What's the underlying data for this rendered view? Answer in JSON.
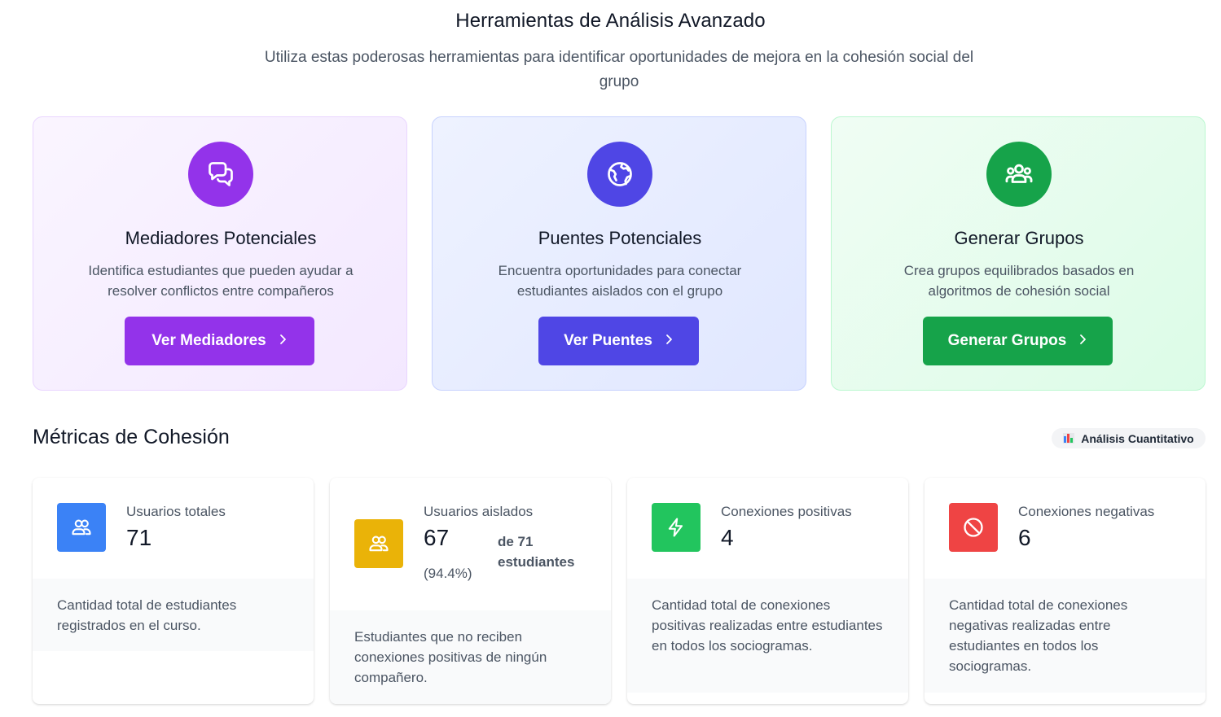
{
  "header": {
    "title": "Herramientas de Análisis Avanzado",
    "subtitle": "Utiliza estas poderosas herramientas para identificar oportunidades de mejora en la cohesión social del grupo"
  },
  "tools": [
    {
      "title": "Mediadores Potenciales",
      "description": "Identifica estudiantes que pueden ayudar a resolver conflictos entre compañeros",
      "button": "Ver Mediadores",
      "icon": "chat-bubbles-icon",
      "color": "#9333ea"
    },
    {
      "title": "Puentes Potenciales",
      "description": "Encuentra oportunidades para conectar estudiantes aislados con el grupo",
      "button": "Ver Puentes",
      "icon": "globe-icon",
      "color": "#4f46e5"
    },
    {
      "title": "Generar Grupos",
      "description": "Crea grupos equilibrados basados en algoritmos de cohesión social",
      "button": "Generar Grupos",
      "icon": "user-group-icon",
      "color": "#16a34a"
    }
  ],
  "metrics": {
    "title": "Métricas de Cohesión",
    "badge": "Análisis Cuantitativo",
    "cards": [
      {
        "label": "Usuarios totales",
        "value": "71",
        "description": "Cantidad total de estudiantes registrados en el curso.",
        "icon": "users-icon",
        "color": "#3b82f6"
      },
      {
        "label": "Usuarios aislados",
        "value": "67",
        "percent": "(94.4%)",
        "of": "de 71 estudiantes",
        "description": "Estudiantes que no reciben conexiones positivas de ningún compañero.",
        "icon": "users-icon",
        "color": "#eab308"
      },
      {
        "label": "Conexiones positivas",
        "value": "4",
        "description": "Cantidad total de conexiones positivas realizadas entre estudiantes en todos los sociogramas.",
        "icon": "lightning-icon",
        "color": "#22c55e"
      },
      {
        "label": "Conexiones negativas",
        "value": "6",
        "description": "Cantidad total de conexiones negativas realizadas entre estudiantes en todos los sociogramas.",
        "icon": "prohibited-icon",
        "color": "#ef4444"
      }
    ]
  }
}
